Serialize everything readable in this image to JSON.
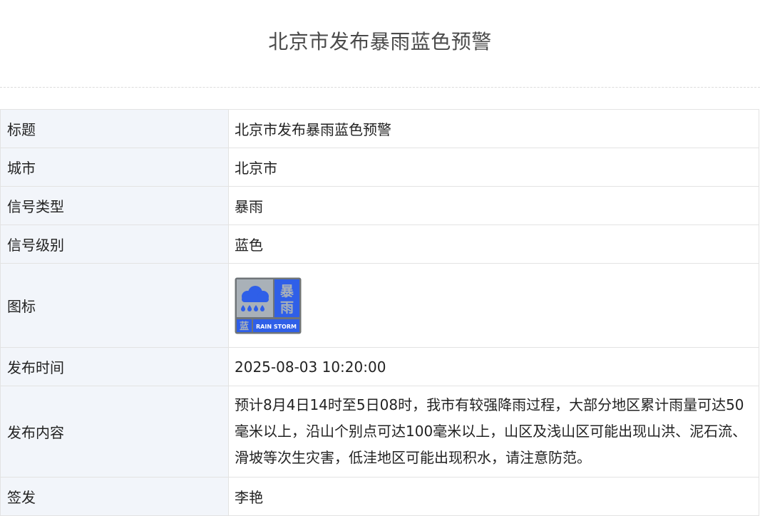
{
  "page": {
    "title": "北京市发布暴雨蓝色预警"
  },
  "table": {
    "rows": [
      {
        "label": "标题",
        "value": "北京市发布暴雨蓝色预警"
      },
      {
        "label": "城市",
        "value": "北京市"
      },
      {
        "label": "信号类型",
        "value": "暴雨"
      },
      {
        "label": "信号级别",
        "value": "蓝色"
      },
      {
        "label": "图标"
      },
      {
        "label": "发布时间",
        "value": "2025-08-03 10:20:00"
      },
      {
        "label": "发布内容",
        "value": "预计8月4日14时至5日08时，我市有较强降雨过程，大部分地区累计雨量可达50毫米以上，沿山个别点可达100毫米以上，山区及浅山区可能出现山洪、泥石流、滑坡等次生灾害，低洼地区可能出现积水，请注意防范。"
      },
      {
        "label": "签发",
        "value": "李艳"
      }
    ]
  },
  "warning_icon": {
    "icon_name": "rainstorm-blue-warning-icon",
    "title_char_top": "暴",
    "title_char_bottom": "雨",
    "level_char": "蓝",
    "english_label": "RAIN STORM",
    "colors": {
      "frame": "#6f7478",
      "panel_bg": "#a9b1b8",
      "blue": "#2f5fe8",
      "cloud": "#2f5fe8"
    }
  }
}
